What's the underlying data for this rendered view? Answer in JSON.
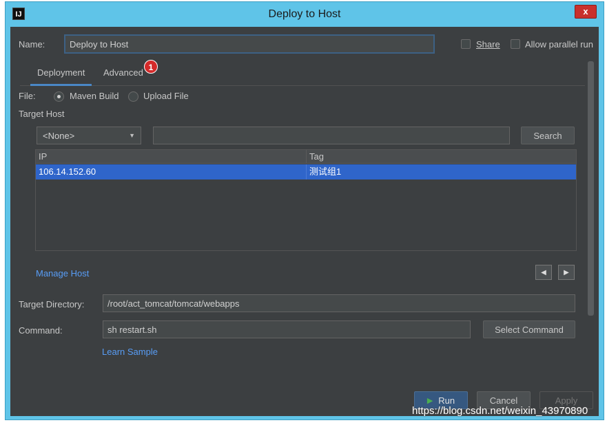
{
  "window": {
    "title": "Deploy to Host",
    "app_icon_text": "IJ",
    "close_label": "x"
  },
  "name_row": {
    "label": "Name:",
    "value": "Deploy to Host",
    "share_label": "Share",
    "allow_parallel_label": "Allow parallel run"
  },
  "tabs": [
    {
      "label": "Deployment",
      "active": true
    },
    {
      "label": "Advanced",
      "active": false
    }
  ],
  "badge": "1",
  "file_row": {
    "label": "File:",
    "options": [
      {
        "label": "Maven Build",
        "checked": true
      },
      {
        "label": "Upload File",
        "checked": false
      }
    ]
  },
  "target_host": {
    "label": "Target Host",
    "combo_value": "<None>",
    "search_value": "",
    "search_button": "Search"
  },
  "table": {
    "columns": [
      "IP",
      "Tag"
    ],
    "rows": [
      {
        "ip": "106.14.152.60",
        "tag": "测试组1",
        "selected": true
      }
    ]
  },
  "manage_host": "Manage Host",
  "target_directory": {
    "label": "Target Directory:",
    "value": "/root/act_tomcat/tomcat/webapps"
  },
  "command": {
    "label": "Command:",
    "value": "sh restart.sh",
    "select_button": "Select Command"
  },
  "learn_sample": "Learn Sample",
  "footer": {
    "run": "Run",
    "cancel": "Cancel",
    "apply": "Apply"
  },
  "watermark": "https://blog.csdn.net/weixin_43970890",
  "colors": {
    "title_bar": "#5fc4e8",
    "panel": "#3c3f41",
    "accent": "#4a88c7",
    "selection": "#2f65ca",
    "link": "#589df6"
  }
}
